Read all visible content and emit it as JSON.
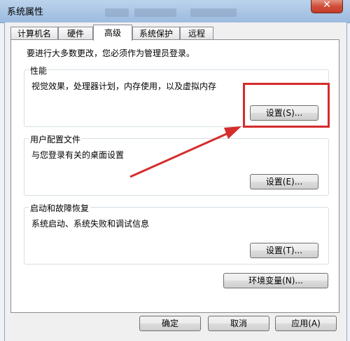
{
  "window": {
    "title": "系统属性",
    "close_label": "✕"
  },
  "tabs": [
    {
      "label": "计算机名"
    },
    {
      "label": "硬件"
    },
    {
      "label": "高级"
    },
    {
      "label": "系统保护"
    },
    {
      "label": "远程"
    }
  ],
  "advanced": {
    "admin_notice": "要进行大多数更改，您必须作为管理员登录。",
    "performance": {
      "title": "性能",
      "description": "视觉效果，处理器计划，内存使用，以及虚拟内存",
      "button": "设置(S)..."
    },
    "user_profiles": {
      "title": "用户配置文件",
      "description": "与您登录有关的桌面设置",
      "button": "设置(E)..."
    },
    "startup_recovery": {
      "title": "启动和故障恢复",
      "description": "系统启动、系统失败和调试信息",
      "button": "设置(T)..."
    },
    "env_vars_button": "环境变量(N)..."
  },
  "footer": {
    "ok": "确定",
    "cancel": "取消",
    "apply": "应用(A)"
  },
  "annotation": {
    "color": "#d62c2c"
  }
}
